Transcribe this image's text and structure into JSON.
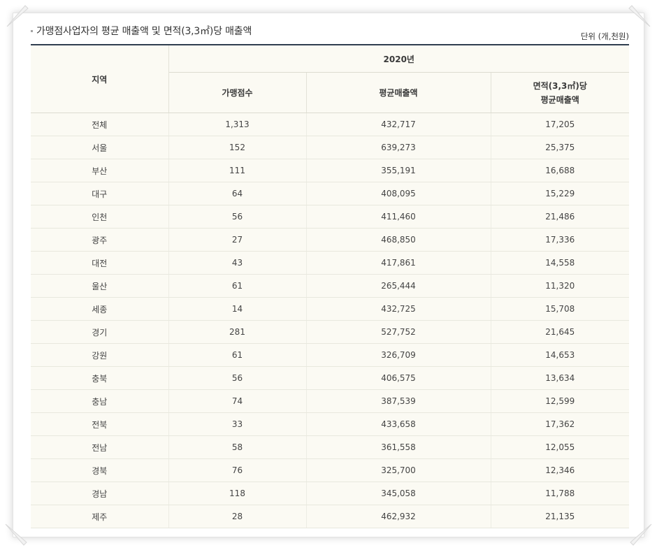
{
  "title": "가맹점사업자의 평균 매출액 및 면적(3,3㎡)당 매출액",
  "unit": "단위 (개,천원)",
  "header": {
    "region": "지역",
    "year": "2020년",
    "col_stores": "가맹점수",
    "col_avg_sales": "평균매출액",
    "col_area_line1": "면적(3,3㎡)당",
    "col_area_line2": "평균매출액"
  },
  "rows": [
    {
      "region": "전체",
      "stores": "1,313",
      "avg_sales": "432,717",
      "area_sales": "17,205"
    },
    {
      "region": "서울",
      "stores": "152",
      "avg_sales": "639,273",
      "area_sales": "25,375"
    },
    {
      "region": "부산",
      "stores": "111",
      "avg_sales": "355,191",
      "area_sales": "16,688"
    },
    {
      "region": "대구",
      "stores": "64",
      "avg_sales": "408,095",
      "area_sales": "15,229"
    },
    {
      "region": "인천",
      "stores": "56",
      "avg_sales": "411,460",
      "area_sales": "21,486"
    },
    {
      "region": "광주",
      "stores": "27",
      "avg_sales": "468,850",
      "area_sales": "17,336"
    },
    {
      "region": "대전",
      "stores": "43",
      "avg_sales": "417,861",
      "area_sales": "14,558"
    },
    {
      "region": "울산",
      "stores": "61",
      "avg_sales": "265,444",
      "area_sales": "11,320"
    },
    {
      "region": "세종",
      "stores": "14",
      "avg_sales": "432,725",
      "area_sales": "15,708"
    },
    {
      "region": "경기",
      "stores": "281",
      "avg_sales": "527,752",
      "area_sales": "21,645"
    },
    {
      "region": "강원",
      "stores": "61",
      "avg_sales": "326,709",
      "area_sales": "14,653"
    },
    {
      "region": "충북",
      "stores": "56",
      "avg_sales": "406,575",
      "area_sales": "13,634"
    },
    {
      "region": "충남",
      "stores": "74",
      "avg_sales": "387,539",
      "area_sales": "12,599"
    },
    {
      "region": "전북",
      "stores": "33",
      "avg_sales": "433,658",
      "area_sales": "17,362"
    },
    {
      "region": "전남",
      "stores": "58",
      "avg_sales": "361,558",
      "area_sales": "12,055"
    },
    {
      "region": "경북",
      "stores": "76",
      "avg_sales": "325,700",
      "area_sales": "12,346"
    },
    {
      "region": "경남",
      "stores": "118",
      "avg_sales": "345,058",
      "area_sales": "11,788"
    },
    {
      "region": "제주",
      "stores": "28",
      "avg_sales": "462,932",
      "area_sales": "21,135"
    }
  ]
}
